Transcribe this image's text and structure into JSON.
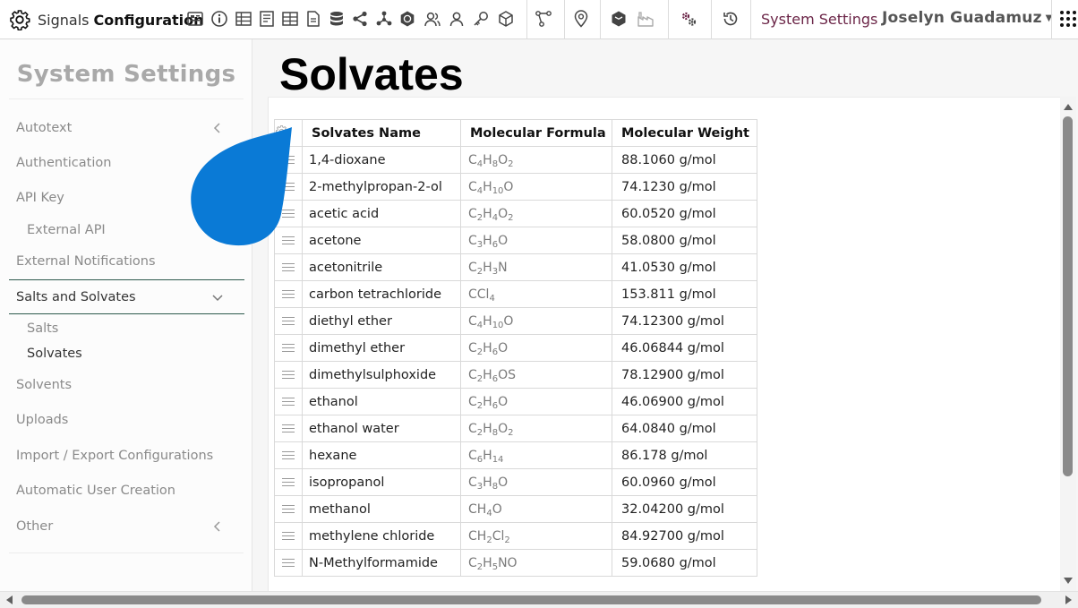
{
  "navbar": {
    "brand_prefix": "Signals",
    "brand_name": "Configuration",
    "tool_icons": [
      "dashboard-icon",
      "info-icon",
      "table-icon",
      "document-icon",
      "grid-icon",
      "file-icon",
      "database-icon",
      "share-icon",
      "hierarchy-icon",
      "hexagon-badge-icon",
      "users-icon",
      "user-icon",
      "key-icon",
      "cube-icon",
      "workflow-icon",
      "location-pin-icon",
      "package-icon",
      "factory-icon",
      "settings-gears-icon",
      "history-icon"
    ],
    "system_settings_link": "System Settings",
    "user_name": "Joselyn Guadamuz"
  },
  "sidebar": {
    "title": "System Settings",
    "items": [
      {
        "label": "Autotext"
      },
      {
        "label": "Authentication"
      },
      {
        "label": "API Key"
      },
      {
        "label": "External API"
      },
      {
        "label": "External Notifications"
      },
      {
        "label": "Salts and Solvates"
      },
      {
        "label": "Salts"
      },
      {
        "label": "Solvates"
      },
      {
        "label": "Solvents"
      },
      {
        "label": "Uploads"
      },
      {
        "label": "Import / Export Configurations"
      },
      {
        "label": "Automatic User Creation"
      },
      {
        "label": "Other"
      }
    ]
  },
  "main": {
    "title": "Solvates",
    "table": {
      "columns": [
        "Solvates Name",
        "Molecular Formula",
        "Molecular Weight"
      ],
      "rows": [
        {
          "name": "1,4-dioxane",
          "formula": "C4H8O2",
          "weight": "88.1060 g/mol"
        },
        {
          "name": "2-methylpropan-2-ol",
          "formula": "C4H10O",
          "weight": "74.1230 g/mol"
        },
        {
          "name": "acetic acid",
          "formula": "C2H4O2",
          "weight": "60.0520 g/mol"
        },
        {
          "name": "acetone",
          "formula": "C3H6O",
          "weight": "58.0800 g/mol"
        },
        {
          "name": "acetonitrile",
          "formula": "C2H3N",
          "weight": "41.0530 g/mol"
        },
        {
          "name": "carbon tetrachloride",
          "formula": "CCl4",
          "weight": "153.811 g/mol"
        },
        {
          "name": "diethyl ether",
          "formula": "C4H10O",
          "weight": "74.12300 g/mol"
        },
        {
          "name": "dimethyl ether",
          "formula": "C2H6O",
          "weight": "46.06844 g/mol"
        },
        {
          "name": "dimethylsulphoxide",
          "formula": "C2H6OS",
          "weight": "78.12900 g/mol"
        },
        {
          "name": "ethanol",
          "formula": "C2H6O",
          "weight": "46.06900 g/mol"
        },
        {
          "name": "ethanol water",
          "formula": "C2H8O2",
          "weight": "64.0840 g/mol"
        },
        {
          "name": "hexane",
          "formula": "C6H14",
          "weight": "86.178 g/mol"
        },
        {
          "name": "isopropanol",
          "formula": "C3H8O",
          "weight": "60.0960 g/mol"
        },
        {
          "name": "methanol",
          "formula": "CH4O",
          "weight": "32.04200 g/mol"
        },
        {
          "name": "methylene chloride",
          "formula": "CH2Cl2",
          "weight": "84.92700 g/mol"
        },
        {
          "name": "N-Methylformamide",
          "formula": "C2H5NO",
          "weight": "59.0680 g/mol"
        }
      ]
    }
  },
  "colors": {
    "system_link": "#6b2547",
    "active_rule": "#2d5a4c",
    "overlay_blob": "#0a7ad6"
  }
}
